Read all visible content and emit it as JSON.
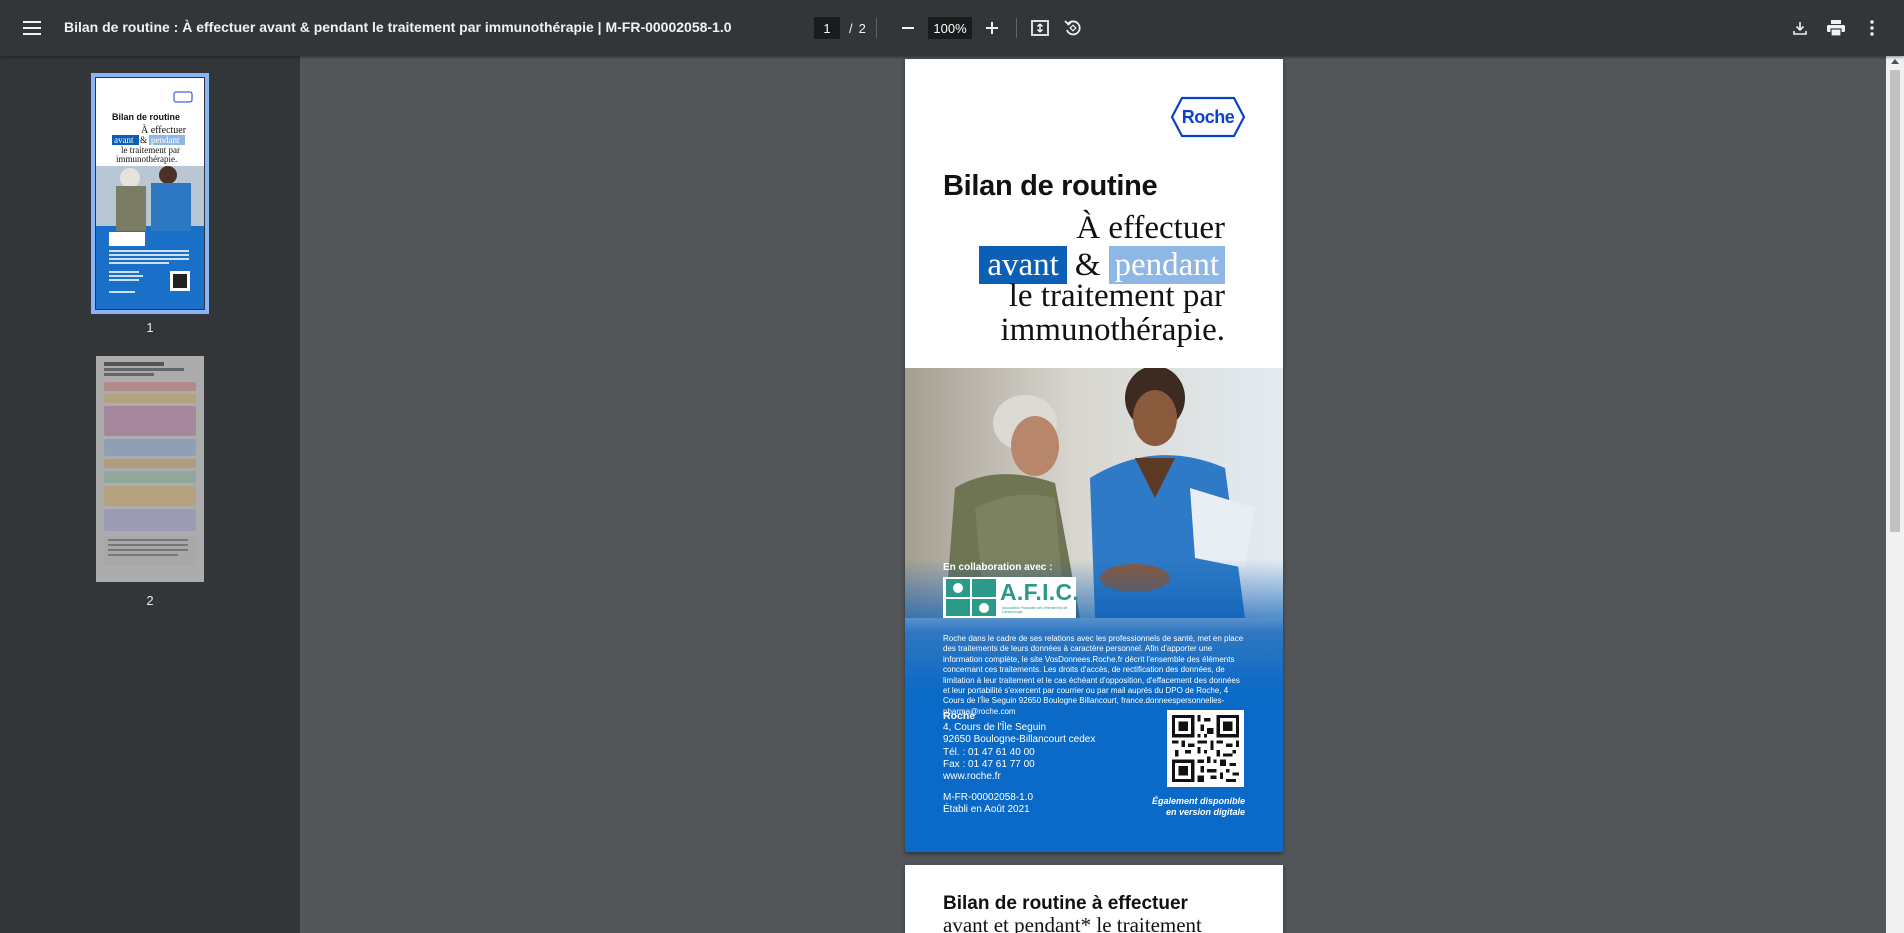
{
  "toolbar": {
    "title": "Bilan de routine : À effectuer avant & pendant le traitement par immunothérapie | M-FR-00002058-1.0",
    "current_page": "1",
    "page_separator": "/",
    "total_pages": "2",
    "zoom": "100%",
    "icons": {
      "menu": "menu-icon",
      "zoom_out": "minus-icon",
      "zoom_in": "plus-icon",
      "fit": "fit-to-page-icon",
      "rotate": "rotate-icon",
      "download": "download-icon",
      "print": "print-icon",
      "more": "more-vert-icon"
    }
  },
  "sidebar": {
    "thumbnails": [
      {
        "label": "1",
        "selected": true
      },
      {
        "label": "2",
        "selected": false
      }
    ]
  },
  "page1": {
    "logo": "Roche",
    "heading": "Bilan de routine",
    "line1": "À effectuer",
    "avant": "avant",
    "amp": "&",
    "pendant": "pendant",
    "line3": "le traitement par",
    "line4": "immunothérapie.",
    "collab": "En collaboration avec :",
    "afic": "A.F.I.C.",
    "afic_sub": "Association Française des Infirmier(e)s de Cancérologie",
    "legal": "Roche dans le cadre de ses relations avec les professionnels de santé, met en place des traitements de leurs données à caractère personnel. Afin d'apporter une information complète, le site VosDonnees.Roche.fr décrit l'ensemble des éléments concernant ces traitements. Les droits d'accès, de rectification des données, de limitation à leur traitement et le cas échéant d'opposition, d'effacement des données et leur portabilité s'exercent par courrier ou par mail auprès du DPO de Roche, 4 Cours de l'Île Seguin 92650 Boulogne Billancourt, france.donneespersonnelles-pharma@roche.com",
    "address": {
      "company": "Roche",
      "street": "4, Cours de l'Île Seguin",
      "city": "92650 Boulogne-Billancourt cedex",
      "tel": "Tél. : 01 47 61 40 00",
      "fax": "Fax : 01 47 61 77 00",
      "web": "www.roche.fr"
    },
    "ref_code": "M-FR-00002058-1.0",
    "established": "Établi en Août 2021",
    "digital_line1": "Également disponible",
    "digital_line2": "en version digitale"
  },
  "page2": {
    "title": "Bilan de routine à effectuer",
    "subtitle": "avant et pendant* le traitement"
  },
  "colors": {
    "toolbar_bg": "#323639",
    "viewer_bg": "#525659",
    "roche_blue": "#0b41cd",
    "highlight_dark": "#0b5fb6",
    "highlight_light": "#8fb7e5",
    "thumb_selected": "#8ab4f8"
  }
}
